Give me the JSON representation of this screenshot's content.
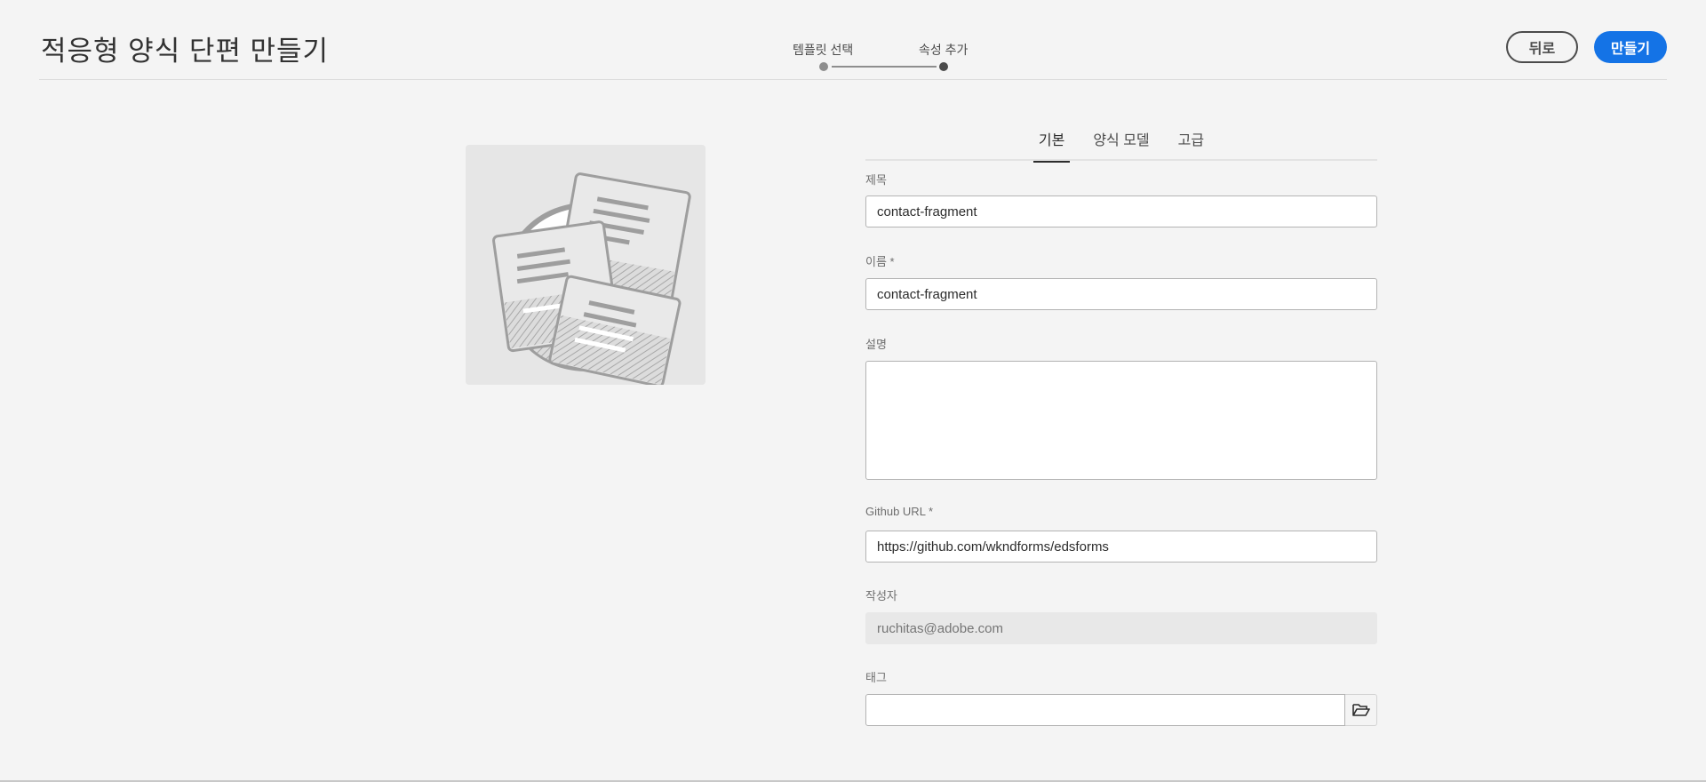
{
  "header": {
    "title": "적응형 양식 단편 만들기",
    "steps": [
      "템플릿 선택",
      "속성 추가"
    ],
    "back_label": "뒤로",
    "create_label": "만들기"
  },
  "tabs": [
    "기본",
    "양식 모델",
    "고급"
  ],
  "form": {
    "title_label": "제목",
    "title_value": "contact-fragment",
    "name_label": "이름 *",
    "name_value": "contact-fragment",
    "description_label": "설명",
    "description_value": "",
    "github_label": "Github URL *",
    "github_value": "https://github.com/wkndforms/edsforms",
    "author_label": "작성자",
    "author_placeholder": "ruchitas@adobe.com",
    "tags_label": "태그",
    "tags_value": ""
  },
  "colors": {
    "accent": "#1473e6",
    "background": "#f4f4f4"
  },
  "icons": {
    "thumbnail": "form-fragment-illustration",
    "tag_picker": "folder-open-icon"
  }
}
